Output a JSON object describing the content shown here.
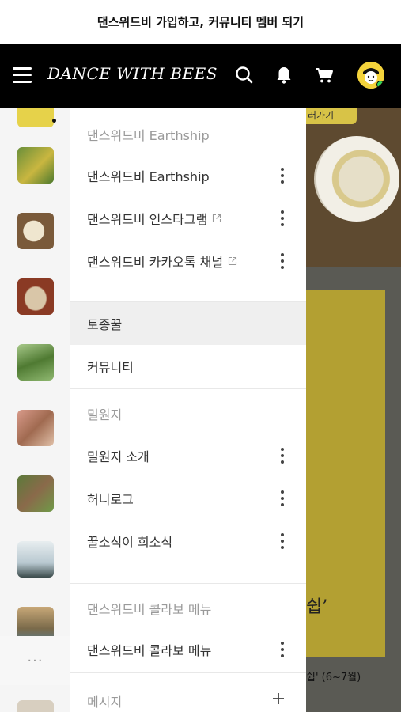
{
  "banner": {
    "text": "댄스위드비 가입하고, 커뮤니티 멤버 되기"
  },
  "header": {
    "logo": "DANCE WITH BEES",
    "icons": [
      "menu-icon",
      "search-icon",
      "bell-icon",
      "cart-icon",
      "avatar"
    ]
  },
  "background": {
    "tag": "러가기",
    "headline": "쉽’",
    "caption": "쉽' (6~7월)"
  },
  "rail": {
    "more": "···"
  },
  "drawer": {
    "sections": [
      {
        "title": "댄스위드비 Earthship",
        "items": [
          {
            "label": "댄스위드비 Earthship"
          },
          {
            "label": "댄스위드비 인스타그램"
          },
          {
            "label": "댄스위드비 카카오톡 채널"
          }
        ]
      },
      {
        "title": "",
        "items": [
          {
            "label": "토종꿀"
          },
          {
            "label": "커뮤니티"
          }
        ]
      },
      {
        "title": "밀원지",
        "items": [
          {
            "label": "밀원지 소개"
          },
          {
            "label": "허니로그"
          },
          {
            "label": "꿀소식이 희소식"
          }
        ]
      },
      {
        "title": "댄스위드비 콜라보 메뉴",
        "items": [
          {
            "label": "댄스위드비 콜라보 메뉴"
          }
        ]
      },
      {
        "title": "메시지",
        "items": []
      }
    ]
  },
  "colors": {
    "header_bg": "#000000",
    "accent_yellow": "#b3a032",
    "active_row": "#efefef"
  }
}
